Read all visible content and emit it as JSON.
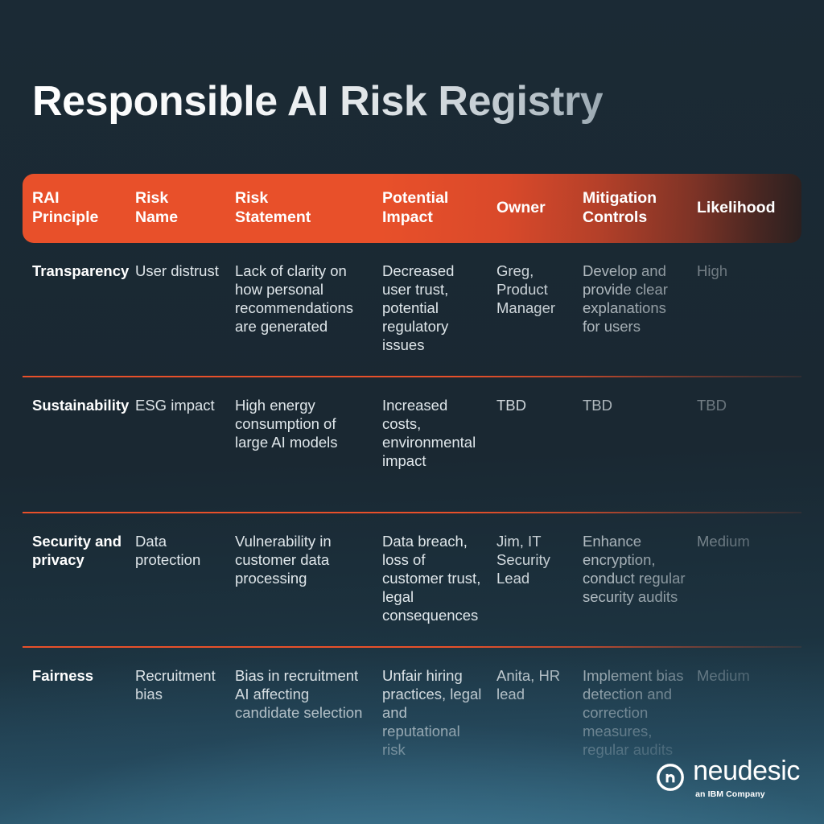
{
  "page": {
    "title": "Responsible AI Risk Registry",
    "accent_color": "#E8502A",
    "background_top_color": "#1B2A35",
    "background_bottom_color": "#33687F"
  },
  "table": {
    "columns": [
      {
        "label": "RAI\nPrinciple",
        "line1": "RAI",
        "line2": "Principle"
      },
      {
        "label": "Risk\nName",
        "line1": "Risk",
        "line2": "Name"
      },
      {
        "label": "Risk\nStatement",
        "line1": "Risk",
        "line2": "Statement"
      },
      {
        "label": "Potential\nImpact",
        "line1": "Potential",
        "line2": "Impact"
      },
      {
        "label": "Owner",
        "line1": "Owner",
        "line2": ""
      },
      {
        "label": "Mitigation\nControls",
        "line1": "Mitigation",
        "line2": "Controls"
      },
      {
        "label": "Likelihood",
        "line1": "Likelihood",
        "line2": ""
      }
    ],
    "rows": [
      {
        "principle": "Transparency",
        "risk_name": "User distrust",
        "risk_statement": "Lack of clarity on how personal recommendations are generated",
        "potential_impact": "Decreased user trust, potential regulatory issues",
        "owner": "Greg, Product Manager",
        "mitigation_controls": "Develop and provide clear explanations for users",
        "likelihood": "High"
      },
      {
        "principle": "Sustainability",
        "risk_name": "ESG impact",
        "risk_statement": "High energy consumption of large AI models",
        "potential_impact": "Increased costs, environmental impact",
        "owner": "TBD",
        "mitigation_controls": "TBD",
        "likelihood": "TBD"
      },
      {
        "principle": "Security and privacy",
        "risk_name": "Data protection",
        "risk_statement": "Vulnerability in customer data processing",
        "potential_impact": "Data breach, loss of customer trust, legal consequences",
        "owner": "Jim, IT Security Lead",
        "mitigation_controls": "Enhance encryption, conduct regular security audits",
        "likelihood": "Medium"
      },
      {
        "principle": "Fairness",
        "risk_name": "Recruitment bias",
        "risk_statement": "Bias in recruitment AI affecting candidate selection",
        "potential_impact": "Unfair hiring practices, legal and reputational risk",
        "owner": "Anita, HR lead",
        "mitigation_controls": "Implement bias detection and correction measures, regular audits",
        "likelihood": "Medium"
      }
    ]
  },
  "logo": {
    "wordmark": "neudesic",
    "tagline": "an IBM Company",
    "mark_icon": "neudesic-circle-n-icon"
  }
}
